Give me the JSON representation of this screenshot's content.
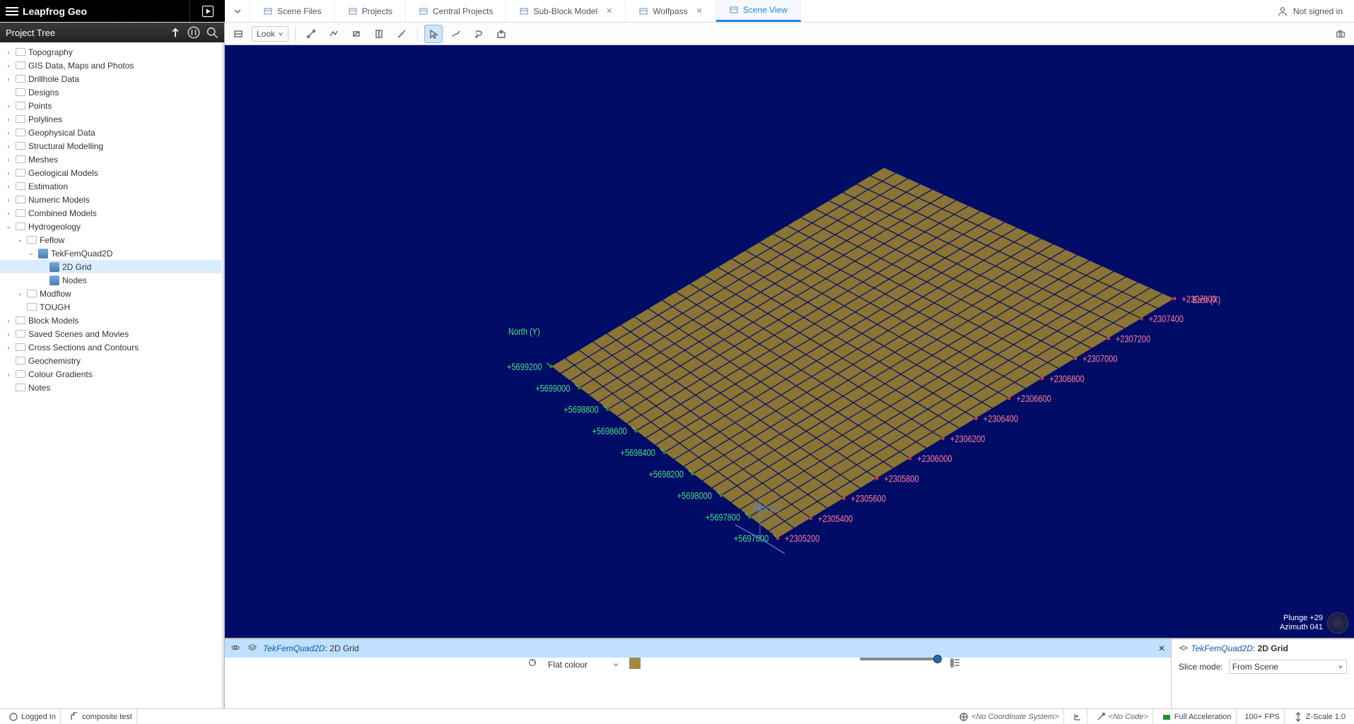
{
  "app": {
    "title": "Leapfrog Geo"
  },
  "tabs": [
    {
      "label": "Scene Files",
      "closable": false
    },
    {
      "label": "Projects",
      "closable": false
    },
    {
      "label": "Central Projects",
      "closable": false
    },
    {
      "label": "Sub-Block Model",
      "closable": true
    },
    {
      "label": "Wolfpass",
      "closable": true
    },
    {
      "label": "Scene View",
      "closable": false,
      "active": true
    }
  ],
  "user": {
    "status": "Not signed in"
  },
  "project_tree": {
    "title": "Project Tree",
    "root": [
      {
        "label": "Topography",
        "expandable": true,
        "depth": 0
      },
      {
        "label": "GIS Data, Maps and Photos",
        "expandable": true,
        "depth": 0
      },
      {
        "label": "Drillhole Data",
        "expandable": true,
        "depth": 0
      },
      {
        "label": "Designs",
        "expandable": false,
        "depth": 0
      },
      {
        "label": "Points",
        "expandable": true,
        "depth": 0
      },
      {
        "label": "Polylines",
        "expandable": true,
        "depth": 0
      },
      {
        "label": "Geophysical Data",
        "expandable": true,
        "depth": 0
      },
      {
        "label": "Structural Modelling",
        "expandable": true,
        "depth": 0
      },
      {
        "label": "Meshes",
        "expandable": true,
        "depth": 0
      },
      {
        "label": "Geological Models",
        "expandable": true,
        "depth": 0
      },
      {
        "label": "Estimation",
        "expandable": true,
        "depth": 0
      },
      {
        "label": "Numeric Models",
        "expandable": true,
        "depth": 0
      },
      {
        "label": "Combined Models",
        "expandable": true,
        "depth": 0
      },
      {
        "label": "Hydrogeology",
        "expandable": true,
        "expanded": true,
        "depth": 0
      },
      {
        "label": "Feflow",
        "expandable": true,
        "expanded": true,
        "depth": 1
      },
      {
        "label": "TekFemQuad2D",
        "expandable": true,
        "expanded": true,
        "depth": 2,
        "icon": "feflow"
      },
      {
        "label": "2D Grid",
        "expandable": false,
        "depth": 3,
        "selected": true,
        "icon": "grid"
      },
      {
        "label": "Nodes",
        "expandable": false,
        "depth": 3,
        "icon": "nodes"
      },
      {
        "label": "Modflow",
        "expandable": true,
        "depth": 1
      },
      {
        "label": "TOUGH",
        "expandable": false,
        "depth": 1
      },
      {
        "label": "Block Models",
        "expandable": true,
        "depth": 0
      },
      {
        "label": "Saved Scenes and Movies",
        "expandable": true,
        "depth": 0
      },
      {
        "label": "Cross Sections and Contours",
        "expandable": true,
        "depth": 0
      },
      {
        "label": "Geochemistry",
        "expandable": false,
        "depth": 0
      },
      {
        "label": "Colour Gradients",
        "expandable": true,
        "depth": 0
      },
      {
        "label": "Notes",
        "expandable": false,
        "depth": 0
      }
    ]
  },
  "toolbar": {
    "look_label": "Look"
  },
  "viewport": {
    "north_label": "North (Y)",
    "east_label": "East (X)",
    "elev_label": "Elev (Z)",
    "north_ticks": [
      "+5699200",
      "+5699000",
      "+5698800",
      "+5698600",
      "+5698400",
      "+5698200",
      "+5698000",
      "+5697800",
      "+5697600"
    ],
    "east_ticks": [
      "+2307600",
      "+2307400",
      "+2307200",
      "+2307000",
      "+2306800",
      "+2306600",
      "+2306400",
      "+2306200",
      "+2306000",
      "+2305800",
      "+2305600",
      "+2305400",
      "+2305200"
    ],
    "plunge": "Plunge +29",
    "azimuth": "Azimuth 041"
  },
  "scene_item": {
    "source": "TekFemQuad2D",
    "name": "2D Grid",
    "color_mode": "Flat colour",
    "color_hex": "#a48b3a"
  },
  "props": {
    "source": "TekFemQuad2D",
    "name": "2D Grid",
    "slice_mode_label": "Slice mode:",
    "slice_mode_value": "From Scene"
  },
  "status": {
    "logged_in": "Logged In",
    "job": "composite test",
    "coord_sys": "<No Coordinate System>",
    "code": "<No Code>",
    "accel": "Full Acceleration",
    "fps": "100+ FPS",
    "zscale": "Z-Scale 1.0"
  }
}
